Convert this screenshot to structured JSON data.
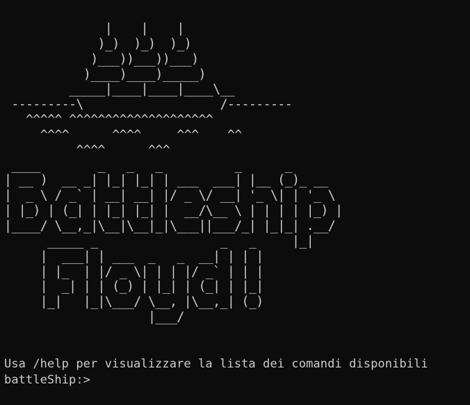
{
  "terminal": {
    "ascii_art": "              |    |    |\n             )_)  )_)  )_)\n            )___))___))___)\n           )____)____)_____)\n         _____|____|____|____\\__\n ---------\\                   /---------\n   ^^^^^ ^^^^^^^^^^^^^^^^^^^^\n     ^^^^      ^^^^     ^^^    ^^\n          ^^^^      ^^^\n ____        _   _   _          _      _\n| __ )  __ _| |_| |_| | ___  ___| |__ (_)_ __\n|  _ \\ / _` | __| __| |/ _ \\/ __| '_ \\| | '_ \\\n| |_) | (_| | |_| |_| |  __/\\__ \\ | | | | |_) |\n|____/ \\__,_|\\__|\\__|_|\\___||___/_| |_|_| .__/\n      _____ _                 _   _     |_|\n     |  ___| | ___  _   _  __| | | |\n     | |_  | |/ _ \\| | | |/ _` | | |\n     |  _| | | (_) | |_| | (_| | |_|\n     |_|   |_|\\___/ \\__, |\\__,_| (_)\n                    |___/",
    "info_message": "Usa /help per visualizzare la lista dei comandi disponibili",
    "prompt": "battleShip:>",
    "input_value": ""
  },
  "colors": {
    "background": "#0c0c0c",
    "foreground": "#cccccc"
  }
}
